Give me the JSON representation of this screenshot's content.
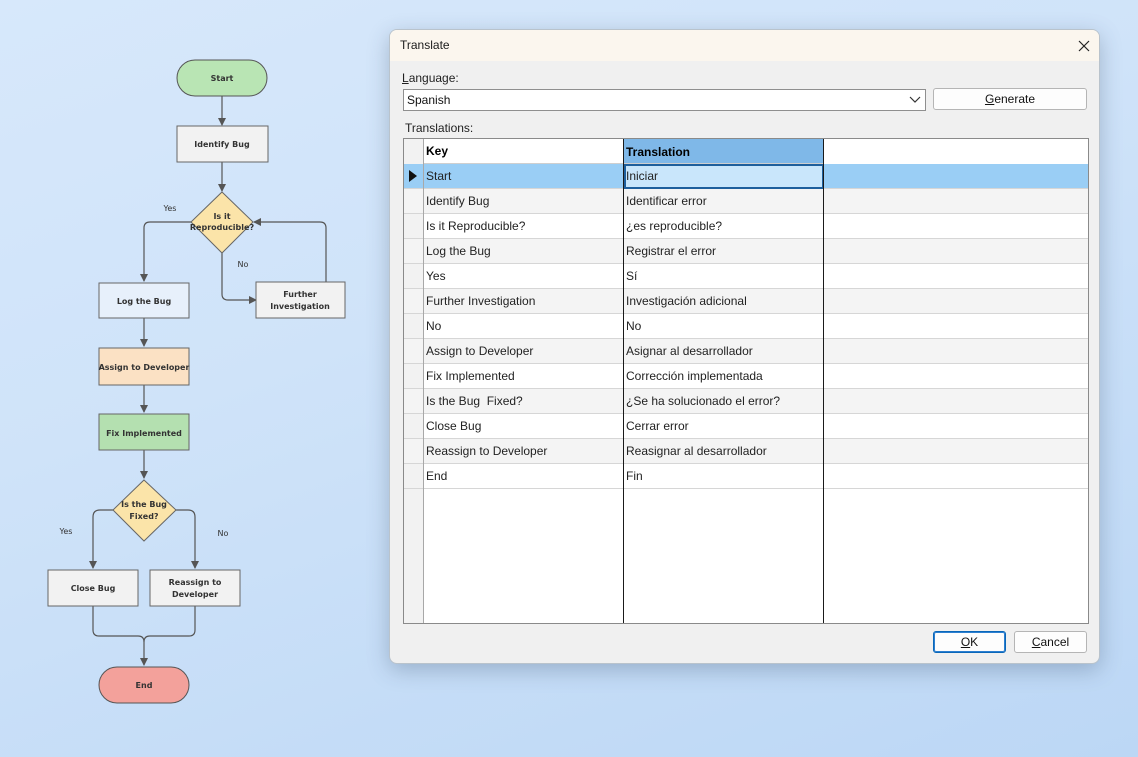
{
  "flowchart": {
    "nodes": {
      "start": "Start",
      "identify_bug": "Identify Bug",
      "reproducible_l1": "Is it",
      "reproducible_l2": "Reproducible?",
      "log_bug": "Log the Bug",
      "further_l1": "Further",
      "further_l2": "Investigation",
      "assign": "Assign to Developer",
      "fix": "Fix Implemented",
      "fixed_l1": "Is the Bug",
      "fixed_l2": "Fixed?",
      "close_bug": "Close Bug",
      "reassign_l1": "Reassign to",
      "reassign_l2": "Developer",
      "end": "End"
    },
    "edge_labels": {
      "yes_1": "Yes",
      "no_1": "No",
      "yes_2": "Yes",
      "no_2": "No"
    },
    "colors": {
      "start_fill": "#b9e5b4",
      "end_fill": "#f3a19b",
      "process_fill": "#f2f2f2",
      "log_fill": "#e7f0fb",
      "assign_fill": "#fbe1c4",
      "fix_fill": "#b4e0b0",
      "decision_fill": "#fbe4a9",
      "edge_color": "#555555"
    }
  },
  "dialog": {
    "title": "Translate",
    "language_label_u": "L",
    "language_label_rest": "anguage:",
    "language_value": "Spanish",
    "generate_label_u": "G",
    "generate_label_rest": "enerate",
    "translations_label": "Translations:",
    "ok_label_u": "O",
    "ok_label_rest": "K",
    "cancel_label_u": "C",
    "cancel_label_rest": "ancel"
  },
  "grid": {
    "columns": [
      "Key",
      "Translation"
    ],
    "rows": [
      {
        "key": "Start",
        "translation": "Iniciar"
      },
      {
        "key": "Identify Bug",
        "translation": "Identificar error"
      },
      {
        "key": "Is it Reproducible?",
        "translation": "¿es reproducible?"
      },
      {
        "key": "Log the Bug",
        "translation": "Registrar el error"
      },
      {
        "key": "Yes",
        "translation": "Sí"
      },
      {
        "key": "Further Investigation",
        "translation": "Investigación adicional"
      },
      {
        "key": "No",
        "translation": "No"
      },
      {
        "key": "Assign to Developer",
        "translation": "Asignar al desarrollador"
      },
      {
        "key": "Fix Implemented",
        "translation": "Corrección implementada"
      },
      {
        "key": "Is the Bug  Fixed?",
        "translation": "¿Se ha solucionado el error?"
      },
      {
        "key": "Close Bug",
        "translation": "Cerrar error"
      },
      {
        "key": "Reassign to Developer",
        "translation": "Reasignar al desarrollador"
      },
      {
        "key": "End",
        "translation": "Fin"
      }
    ],
    "selected_row": 0,
    "colors": {
      "selected_row": "#9acef5",
      "header_highlight": "#7fb8e8"
    }
  }
}
